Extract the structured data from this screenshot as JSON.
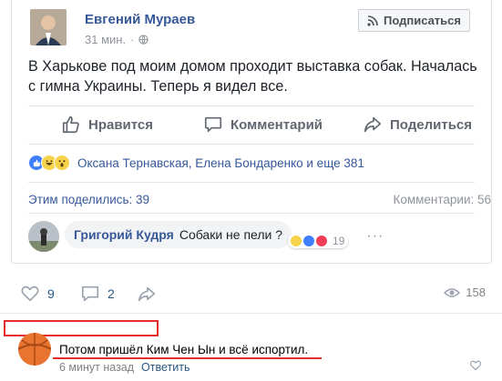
{
  "post": {
    "author": "Евгений Мураев",
    "time": "31 мин.",
    "subscribe_label": "Подписаться",
    "text": "В Харькове под моим домом проходит выставка собак. Началась с гимна Украины. Теперь я видел все.",
    "actions": {
      "like": "Нравится",
      "comment": "Комментарий",
      "share": "Поделиться"
    },
    "reactions_text": "Оксана Тернавская, Елена Бондаренко и еще 381",
    "shared_text": "Этим поделились: 39",
    "comments_text": "Комментарии: 56",
    "comment": {
      "author": "Григорий Кудря",
      "text": "Собаки не пели ?",
      "reaction_count": "19"
    },
    "colors": {
      "link": "#365899",
      "muted": "#90949c"
    }
  },
  "vk": {
    "likes": "9",
    "comments": "2",
    "views": "158",
    "comment": {
      "text": "Потом пришёл Ким Чен Ын и всё испортил.",
      "time": "6 минут назад",
      "reply_label": "Ответить"
    },
    "colors": {
      "highlight": "#e52d2d",
      "link": "#2a5885"
    }
  }
}
